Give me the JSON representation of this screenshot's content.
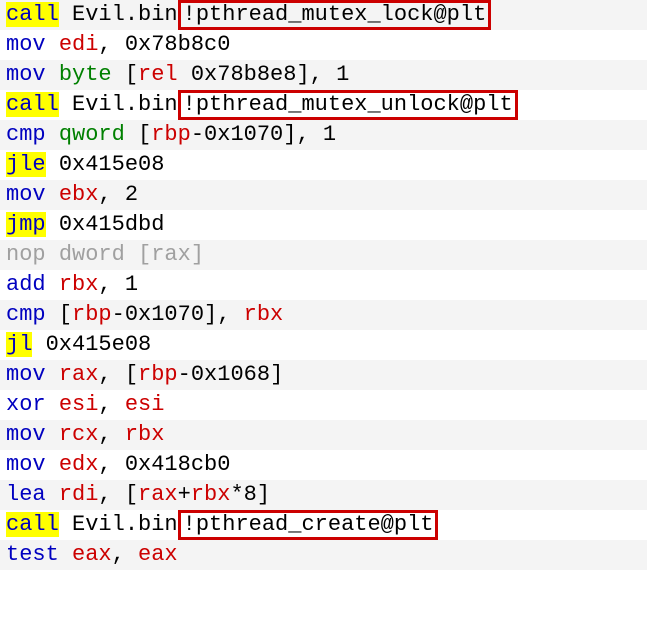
{
  "lines": [
    {
      "bg": "odd",
      "parts": [
        {
          "cls": "kw-yellow",
          "t": "call"
        },
        {
          "cls": "plain",
          "t": " Evil.bin"
        },
        {
          "cls": "plain box",
          "t": "!pthread_mutex_lock@plt"
        }
      ]
    },
    {
      "bg": "even",
      "parts": [
        {
          "cls": "kw-blue",
          "t": "mov"
        },
        {
          "cls": "plain",
          "t": " "
        },
        {
          "cls": "reg-red",
          "t": "edi"
        },
        {
          "cls": "plain",
          "t": ", "
        },
        {
          "cls": "addr",
          "t": "0x78b8c0"
        }
      ]
    },
    {
      "bg": "odd",
      "parts": [
        {
          "cls": "kw-blue",
          "t": "mov"
        },
        {
          "cls": "plain",
          "t": " "
        },
        {
          "cls": "reg-green",
          "t": "byte"
        },
        {
          "cls": "plain",
          "t": " ["
        },
        {
          "cls": "reg-red",
          "t": "rel"
        },
        {
          "cls": "plain",
          "t": " "
        },
        {
          "cls": "addr",
          "t": "0x78b8e8"
        },
        {
          "cls": "plain",
          "t": "], "
        },
        {
          "cls": "addr",
          "t": "1"
        }
      ]
    },
    {
      "bg": "even",
      "parts": [
        {
          "cls": "kw-yellow",
          "t": "call"
        },
        {
          "cls": "plain",
          "t": " Evil.bin"
        },
        {
          "cls": "plain box",
          "t": "!pthread_mutex_unlock@plt"
        }
      ]
    },
    {
      "bg": "odd",
      "parts": [
        {
          "cls": "kw-blue",
          "t": "cmp"
        },
        {
          "cls": "plain",
          "t": " "
        },
        {
          "cls": "reg-green",
          "t": "qword"
        },
        {
          "cls": "plain",
          "t": " ["
        },
        {
          "cls": "reg-red",
          "t": "rbp"
        },
        {
          "cls": "plain",
          "t": "-"
        },
        {
          "cls": "addr",
          "t": "0x1070"
        },
        {
          "cls": "plain",
          "t": "], "
        },
        {
          "cls": "addr",
          "t": "1"
        }
      ]
    },
    {
      "bg": "even",
      "parts": [
        {
          "cls": "kw-yellow",
          "t": "jle"
        },
        {
          "cls": "plain",
          "t": " "
        },
        {
          "cls": "addr",
          "t": "0x415e08"
        }
      ]
    },
    {
      "bg": "odd",
      "parts": [
        {
          "cls": "kw-blue",
          "t": "mov"
        },
        {
          "cls": "plain",
          "t": " "
        },
        {
          "cls": "reg-red",
          "t": "ebx"
        },
        {
          "cls": "plain",
          "t": ", "
        },
        {
          "cls": "addr",
          "t": "2"
        }
      ]
    },
    {
      "bg": "even",
      "parts": [
        {
          "cls": "kw-yellow",
          "t": "jmp"
        },
        {
          "cls": "plain",
          "t": " "
        },
        {
          "cls": "addr",
          "t": "0x415dbd"
        }
      ]
    },
    {
      "bg": "odd",
      "parts": [
        {
          "cls": "gray",
          "t": "nop"
        },
        {
          "cls": "gray",
          "t": " "
        },
        {
          "cls": "gray",
          "t": "dword"
        },
        {
          "cls": "gray",
          "t": " ["
        },
        {
          "cls": "gray",
          "t": "rax"
        },
        {
          "cls": "gray",
          "t": "]"
        }
      ]
    },
    {
      "bg": "even",
      "parts": [
        {
          "cls": "kw-blue",
          "t": "add"
        },
        {
          "cls": "plain",
          "t": " "
        },
        {
          "cls": "reg-red",
          "t": "rbx"
        },
        {
          "cls": "plain",
          "t": ", "
        },
        {
          "cls": "addr",
          "t": "1"
        }
      ]
    },
    {
      "bg": "odd",
      "parts": [
        {
          "cls": "kw-blue",
          "t": "cmp"
        },
        {
          "cls": "plain",
          "t": " ["
        },
        {
          "cls": "reg-red",
          "t": "rbp"
        },
        {
          "cls": "plain",
          "t": "-"
        },
        {
          "cls": "addr",
          "t": "0x1070"
        },
        {
          "cls": "plain",
          "t": "], "
        },
        {
          "cls": "reg-red",
          "t": "rbx"
        }
      ]
    },
    {
      "bg": "even",
      "parts": [
        {
          "cls": "kw-yellow",
          "t": "jl"
        },
        {
          "cls": "plain",
          "t": " "
        },
        {
          "cls": "addr",
          "t": "0x415e08"
        }
      ]
    },
    {
      "bg": "odd",
      "parts": [
        {
          "cls": "kw-blue",
          "t": "mov"
        },
        {
          "cls": "plain",
          "t": " "
        },
        {
          "cls": "reg-red",
          "t": "rax"
        },
        {
          "cls": "plain",
          "t": ", ["
        },
        {
          "cls": "reg-red",
          "t": "rbp"
        },
        {
          "cls": "plain",
          "t": "-"
        },
        {
          "cls": "addr",
          "t": "0x1068"
        },
        {
          "cls": "plain",
          "t": "]"
        }
      ]
    },
    {
      "bg": "even",
      "parts": [
        {
          "cls": "kw-blue",
          "t": "xor"
        },
        {
          "cls": "plain",
          "t": " "
        },
        {
          "cls": "reg-red",
          "t": "esi"
        },
        {
          "cls": "plain",
          "t": ", "
        },
        {
          "cls": "reg-red",
          "t": "esi"
        }
      ]
    },
    {
      "bg": "odd",
      "parts": [
        {
          "cls": "kw-blue",
          "t": "mov"
        },
        {
          "cls": "plain",
          "t": " "
        },
        {
          "cls": "reg-red",
          "t": "rcx"
        },
        {
          "cls": "plain",
          "t": ", "
        },
        {
          "cls": "reg-red",
          "t": "rbx"
        }
      ]
    },
    {
      "bg": "even",
      "parts": [
        {
          "cls": "kw-blue",
          "t": "mov"
        },
        {
          "cls": "plain",
          "t": " "
        },
        {
          "cls": "reg-red",
          "t": "edx"
        },
        {
          "cls": "plain",
          "t": ", "
        },
        {
          "cls": "addr",
          "t": "0x418cb0"
        }
      ]
    },
    {
      "bg": "odd",
      "parts": [
        {
          "cls": "kw-blue",
          "t": "lea"
        },
        {
          "cls": "plain",
          "t": " "
        },
        {
          "cls": "reg-red",
          "t": "rdi"
        },
        {
          "cls": "plain",
          "t": ", ["
        },
        {
          "cls": "reg-red",
          "t": "rax"
        },
        {
          "cls": "plain",
          "t": "+"
        },
        {
          "cls": "reg-red",
          "t": "rbx"
        },
        {
          "cls": "plain",
          "t": "*"
        },
        {
          "cls": "addr",
          "t": "8"
        },
        {
          "cls": "plain",
          "t": "]"
        }
      ]
    },
    {
      "bg": "even",
      "parts": [
        {
          "cls": "kw-yellow",
          "t": "call"
        },
        {
          "cls": "plain",
          "t": " Evil.bin"
        },
        {
          "cls": "plain box",
          "t": "!pthread_create@plt"
        }
      ]
    },
    {
      "bg": "odd",
      "parts": [
        {
          "cls": "kw-blue",
          "t": "test"
        },
        {
          "cls": "plain",
          "t": " "
        },
        {
          "cls": "reg-red",
          "t": "eax"
        },
        {
          "cls": "plain",
          "t": ", "
        },
        {
          "cls": "reg-red",
          "t": "eax"
        }
      ]
    }
  ]
}
